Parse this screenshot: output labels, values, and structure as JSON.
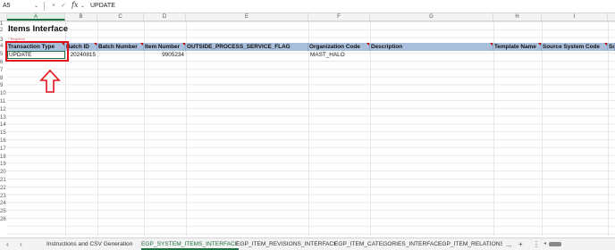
{
  "formula_bar": {
    "name_box": "A5",
    "cancel_icon": "×",
    "enter_icon": "✓",
    "fx_label": "fx",
    "formula_value": "UPDATE"
  },
  "columns": [
    "A",
    "B",
    "C",
    "D",
    "E",
    "F",
    "G",
    "H",
    "I"
  ],
  "selected_column": "A",
  "rows": [
    "1",
    "2",
    "3",
    "4",
    "5",
    "6",
    "7",
    "8",
    "9",
    "10",
    "11",
    "12",
    "13",
    "14",
    "15",
    "16",
    "17",
    "18",
    "19",
    "20",
    "21",
    "22",
    "23",
    "24",
    "25",
    "26"
  ],
  "sheet": {
    "title": "Items Interface",
    "note": "* Required",
    "headers": [
      "Transaction Type",
      "Batch ID",
      "Batch Number",
      "Item Number",
      "OUTSIDE_PROCESS_SERVICE_FLAG",
      "Organization Code",
      "Description",
      "Template Name",
      "Source System Code",
      "Sc"
    ],
    "data_row": [
      "UPDATE",
      "20240815",
      "",
      "9905234",
      "",
      "MAST_HALO",
      "",
      "",
      "",
      ""
    ]
  },
  "tabs": {
    "prev": "‹",
    "next": "›",
    "items": [
      "Instructions and CSV Generation",
      "EGP_SYSTEM_ITEMS_INTERFACE",
      "EGP_ITEM_REVISIONS_INTERFACE",
      "EGP_ITEM_CATEGORIES_INTERFACE",
      "EGP_ITEM_RELATIONSHIP"
    ],
    "active_index": 1,
    "more": "...",
    "add": "+",
    "more_options": "⋮"
  },
  "colors": {
    "header_fill": "#a9bfdc",
    "highlight_red": "#e0121b",
    "accent_green": "#1e7145"
  }
}
